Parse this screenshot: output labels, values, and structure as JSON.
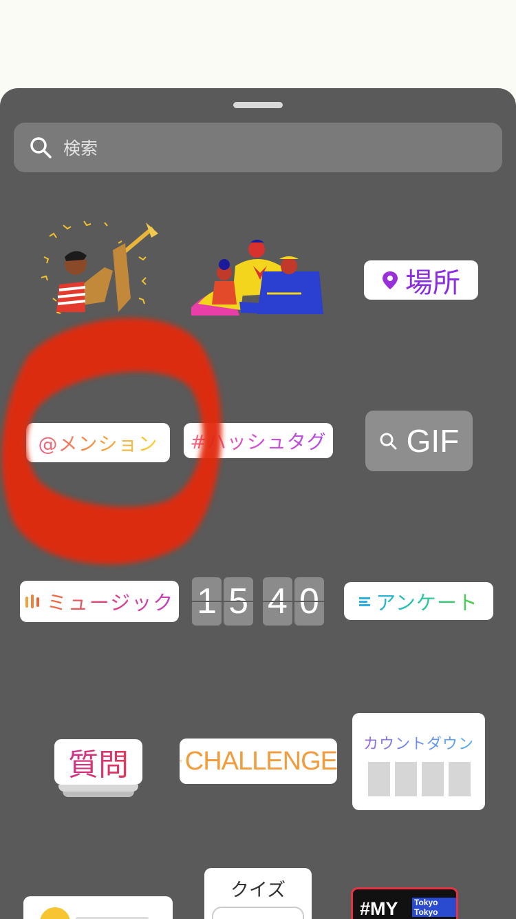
{
  "search": {
    "placeholder": "検索"
  },
  "stickers": {
    "location": "場所",
    "mention": "@メンション",
    "hashtag": "#ハッシュタグ",
    "gif": "GIF",
    "music": "ミュージック",
    "clock": [
      "1",
      "5",
      "4",
      "0"
    ],
    "poll": "アンケート",
    "question": "質問",
    "challenge": "CHALLENGE",
    "countdown": "カウントダウン",
    "quiz": "クイズ",
    "tokyo": {
      "main": "#MY",
      "tag": "Tokyo Tokyo"
    }
  },
  "colors": {
    "sheet": "#5a5a5a",
    "annotation": "#e22a0e",
    "location": "#8a2ee0",
    "challenge": "#f29c3d"
  }
}
